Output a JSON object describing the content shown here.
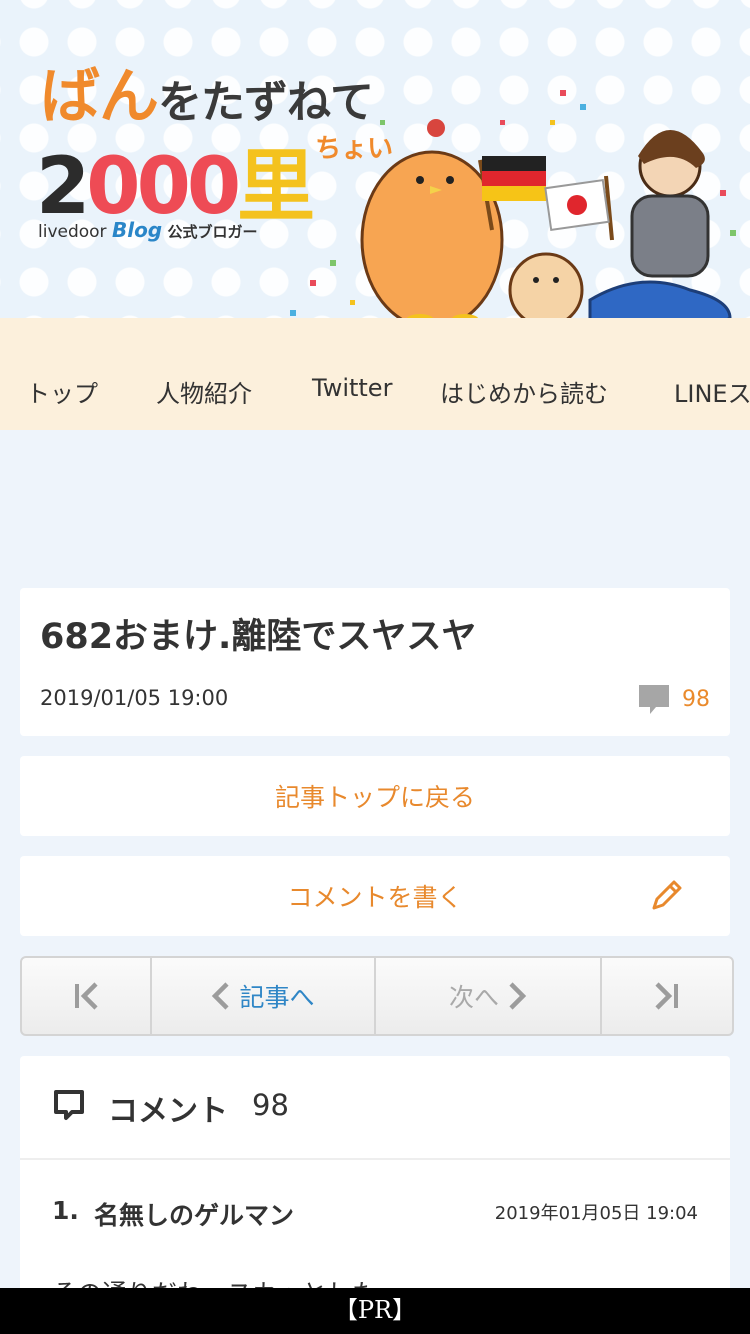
{
  "header": {
    "logo_line1_big": "ばん",
    "logo_line1_rest": "をたずねて",
    "logo_num_1": "2",
    "logo_num_2": "0",
    "logo_num_3": "00",
    "logo_kanji": "里",
    "logo_small": "ちょい",
    "logo_livedoor": "livedoor",
    "logo_blog": "Blog",
    "logo_official": "公式ブロガー"
  },
  "nav": {
    "items": [
      {
        "label": "トップ"
      },
      {
        "label": "人物紹介"
      },
      {
        "label": "Twitter"
      },
      {
        "label": "はじめから読む"
      },
      {
        "label": "LINEスタンプ"
      }
    ]
  },
  "post": {
    "title": "682おまけ.離陸でスヤスヤ",
    "date": "2019/01/05 19:00",
    "comment_count": "98"
  },
  "buttons": {
    "back_to_top": "記事トップに戻る",
    "write_comment": "コメントを書く"
  },
  "pager": {
    "prev": "記事へ",
    "next": "次へ"
  },
  "comments": {
    "label": "コメント",
    "count": "98",
    "items": [
      {
        "index": "1.",
        "name": "名無しのゲルマン",
        "date": "2019年01月05日 19:04",
        "body": "その通りだわ、スカッとした。"
      }
    ]
  },
  "footer": {
    "pr_label": "【PR】"
  },
  "colors": {
    "accent_orange": "#e8892d",
    "link_blue": "#2f86c6",
    "nav_bg": "#fcf0dc",
    "page_bg": "#eef4fb"
  },
  "icons": {
    "comment": "speech-bubble-icon",
    "pencil": "pencil-icon",
    "first": "first-page-icon",
    "prev": "chevron-left-icon",
    "next": "chevron-right-icon",
    "last": "last-page-icon"
  }
}
